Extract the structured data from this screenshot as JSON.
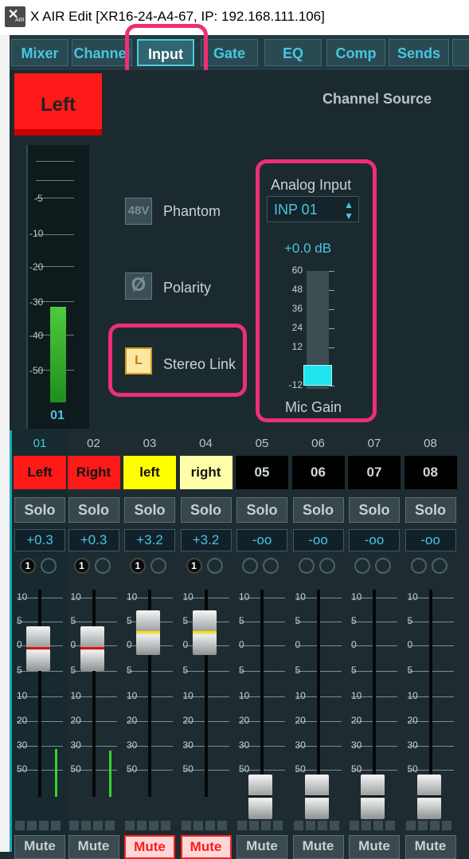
{
  "window": {
    "title": "X AIR Edit [XR16-24-A4-67, IP: 192.168.111.106]",
    "icon_label": "AIR"
  },
  "tabs": [
    {
      "label": "Mixer"
    },
    {
      "label": "Channel"
    },
    {
      "label": "Input"
    },
    {
      "label": "Gate"
    },
    {
      "label": "EQ"
    },
    {
      "label": "Comp"
    },
    {
      "label": "Sends"
    }
  ],
  "active_tab": "Input",
  "channel": {
    "name": "Left",
    "number": "01",
    "meter_scale": [
      "-5",
      "-10",
      "-20",
      "-30",
      "-40",
      "-50"
    ],
    "section_title": "Channel Source",
    "phantom": {
      "badge": "48V",
      "label": "Phantom"
    },
    "polarity": {
      "badge": "Ø",
      "label": "Polarity"
    },
    "stereo_link": {
      "badge": "L",
      "label": "Stereo Link"
    },
    "analog_input": {
      "label": "Analog Input",
      "value": "INP 01"
    },
    "gain": {
      "value": "+0.0 dB",
      "scale": [
        "60",
        "48",
        "36",
        "24",
        "12",
        "-12"
      ],
      "label": "Mic Gain"
    }
  },
  "strips": [
    {
      "num": "01",
      "name": "Left",
      "name_color": "#ff1a1a",
      "text_color": "#111",
      "solo": "Solo",
      "gain": "+0.3",
      "ch1": "1",
      "mute": "Mute",
      "mute_on": false
    },
    {
      "num": "02",
      "name": "Right",
      "name_color": "#ff1a1a",
      "text_color": "#111",
      "solo": "Solo",
      "gain": "+0.3",
      "ch1": "1",
      "mute": "Mute",
      "mute_on": false
    },
    {
      "num": "03",
      "name": "left",
      "name_color": "#ffff00",
      "text_color": "#111",
      "solo": "Solo",
      "gain": "+3.2",
      "ch1": "1",
      "mute": "Mute",
      "mute_on": true
    },
    {
      "num": "04",
      "name": "right",
      "name_color": "#ffffaa",
      "text_color": "#111",
      "solo": "Solo",
      "gain": "+3.2",
      "ch1": "1",
      "mute": "Mute",
      "mute_on": true
    },
    {
      "num": "05",
      "name": "05",
      "name_color": "#000000",
      "text_color": "#cfd8db",
      "solo": "Solo",
      "gain": "-oo",
      "ch1": "",
      "mute": "Mute",
      "mute_on": false
    },
    {
      "num": "06",
      "name": "06",
      "name_color": "#000000",
      "text_color": "#cfd8db",
      "solo": "Solo",
      "gain": "-oo",
      "ch1": "",
      "mute": "Mute",
      "mute_on": false
    },
    {
      "num": "07",
      "name": "07",
      "name_color": "#000000",
      "text_color": "#cfd8db",
      "solo": "Solo",
      "gain": "-oo",
      "ch1": "",
      "mute": "Mute",
      "mute_on": false
    },
    {
      "num": "08",
      "name": "08",
      "name_color": "#000000",
      "text_color": "#cfd8db",
      "solo": "Solo",
      "gain": "-oo",
      "ch1": "",
      "mute": "Mute",
      "mute_on": false
    }
  ],
  "fader_scale": [
    "10",
    "5",
    "0",
    "5",
    "10",
    "20",
    "30",
    "50"
  ]
}
